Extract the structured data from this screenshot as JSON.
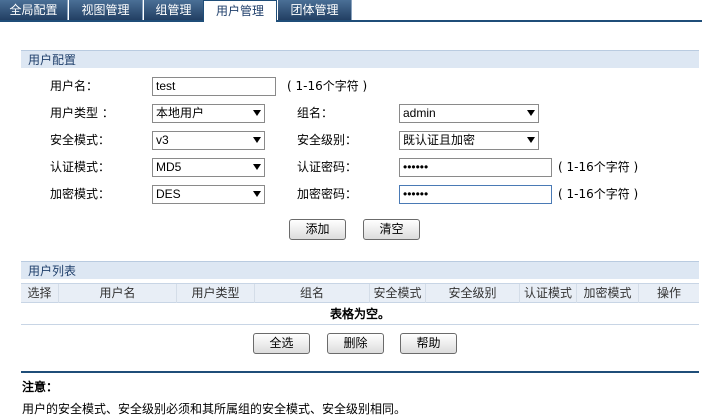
{
  "tabs": [
    {
      "label": "全局配置",
      "active": false
    },
    {
      "label": "视图管理",
      "active": false
    },
    {
      "label": "组管理",
      "active": false
    },
    {
      "label": "用户管理",
      "active": true
    },
    {
      "label": "团体管理",
      "active": false
    }
  ],
  "user_config": {
    "title": "用户配置",
    "username_label": "用户名：",
    "username_value": "test",
    "username_hint": "( 1-16个字符 )",
    "user_type_label": "用户类型 ：",
    "user_type_value": "本地用户",
    "group_label": "组名：",
    "group_value": "admin",
    "security_mode_label": "安全模式：",
    "security_mode_value": "v3",
    "security_level_label": "安全级别：",
    "security_level_value": "既认证且加密",
    "auth_mode_label": "认证模式：",
    "auth_mode_value": "MD5",
    "auth_pwd_label": "认证密码：",
    "auth_pwd_value": "••••••",
    "auth_pwd_hint": "( 1-16个字符 )",
    "enc_mode_label": "加密模式：",
    "enc_mode_value": "DES",
    "enc_pwd_label": "加密密码：",
    "enc_pwd_value": "••••••",
    "enc_pwd_hint": "( 1-16个字符 )",
    "add_label": "添加",
    "clear_label": "清空"
  },
  "user_list": {
    "title": "用户列表",
    "columns": [
      "选择",
      "用户名",
      "用户类型",
      "组名",
      "安全模式",
      "安全级别",
      "认证模式",
      "加密模式",
      "操作"
    ],
    "empty_text": "表格为空。",
    "select_all_label": "全选",
    "delete_label": "删除",
    "help_label": "帮助"
  },
  "note": {
    "title": "注意：",
    "body": "用户的安全模式、安全级别必须和其所属组的安全模式、安全级别相同。"
  }
}
